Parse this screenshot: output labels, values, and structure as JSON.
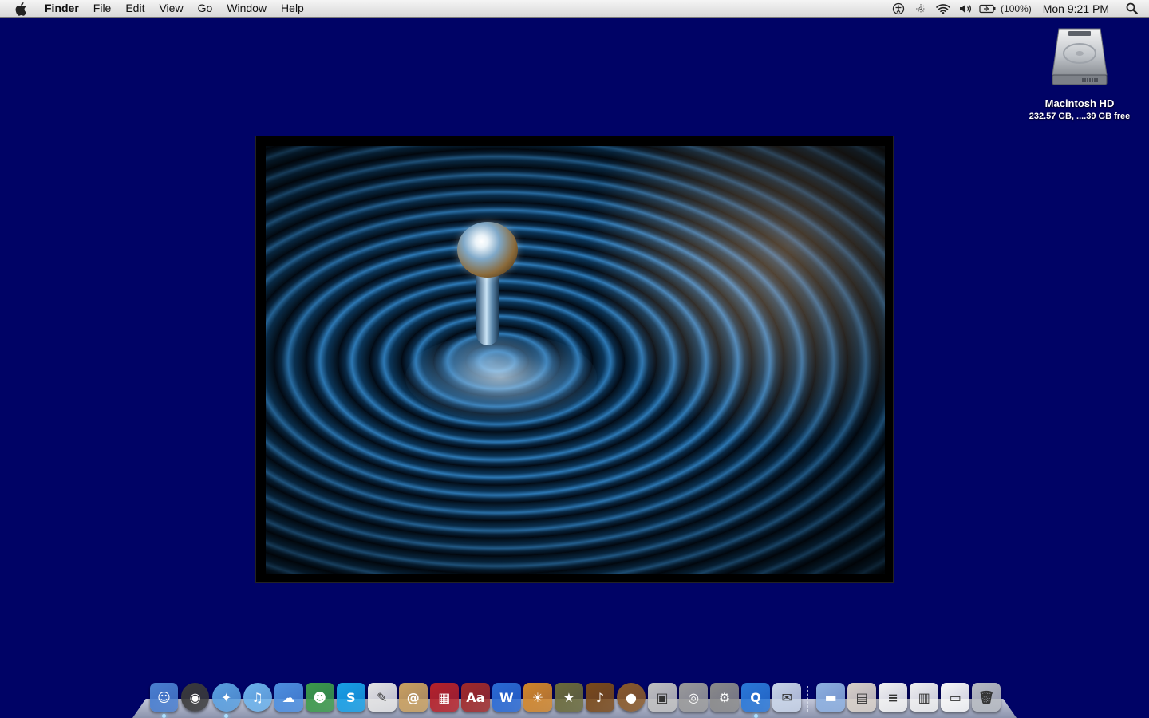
{
  "menubar": {
    "app_name": "Finder",
    "menus": [
      "File",
      "Edit",
      "View",
      "Go",
      "Window",
      "Help"
    ],
    "battery_percent": "(100%)",
    "clock": "Mon 9:21 PM"
  },
  "desktop": {
    "drive_name": "Macintosh HD",
    "drive_info": "232.57 GB, ....39 GB free",
    "background_color": "#000366"
  },
  "dock": {
    "apps": [
      {
        "name": "Finder",
        "icon": "finder-icon",
        "color": "#4a7fd0",
        "glyph": "☺",
        "running": true
      },
      {
        "name": "Dashboard",
        "icon": "dashboard-icon",
        "color": "#3a3a3a",
        "glyph": "◉",
        "running": false
      },
      {
        "name": "Safari",
        "icon": "safari-icon",
        "color": "#5aa0e0",
        "glyph": "✦",
        "running": true
      },
      {
        "name": "iTunes",
        "icon": "itunes-icon",
        "color": "#6db3ec",
        "glyph": "♫",
        "running": false
      },
      {
        "name": "iChat",
        "icon": "ichat-icon",
        "color": "#4d8fe0",
        "glyph": "☁",
        "running": false
      },
      {
        "name": "Messenger",
        "icon": "messenger-icon",
        "color": "#3c9a4a",
        "glyph": "☻",
        "running": false
      },
      {
        "name": "Skype",
        "icon": "skype-icon",
        "color": "#18a0e6",
        "glyph": "S",
        "running": false
      },
      {
        "name": "Preview",
        "icon": "preview-icon",
        "color": "#e4e4e4",
        "glyph": "✎",
        "running": false
      },
      {
        "name": "Address Book",
        "icon": "address-book-icon",
        "color": "#c9a060",
        "glyph": "@",
        "running": false
      },
      {
        "name": "Photo Booth",
        "icon": "photo-booth-icon",
        "color": "#b5222a",
        "glyph": "▦",
        "running": false
      },
      {
        "name": "Dictionary",
        "icon": "dictionary-icon",
        "color": "#a02a2a",
        "glyph": "Aa",
        "running": false
      },
      {
        "name": "iWeb",
        "icon": "iweb-icon",
        "color": "#2a6ad4",
        "glyph": "W",
        "running": false
      },
      {
        "name": "iPhoto",
        "icon": "iphoto-icon",
        "color": "#d0852a",
        "glyph": "☀",
        "running": false
      },
      {
        "name": "iMovie",
        "icon": "imovie-icon",
        "color": "#6a6a3a",
        "glyph": "★",
        "running": false
      },
      {
        "name": "GarageBand",
        "icon": "garageband-icon",
        "color": "#7a4a1a",
        "glyph": "♪",
        "running": false
      },
      {
        "name": "Coconut",
        "icon": "coconut-icon",
        "color": "#8a5a2a",
        "glyph": "●",
        "running": false
      },
      {
        "name": "Image Capture",
        "icon": "image-capture-icon",
        "color": "#c0c0c0",
        "glyph": "▣",
        "running": false
      },
      {
        "name": "DVD Player",
        "icon": "dvd-player-icon",
        "color": "#9a9a9a",
        "glyph": "◎",
        "running": false
      },
      {
        "name": "System Preferences",
        "icon": "system-preferences-icon",
        "color": "#8a8a8a",
        "glyph": "⚙",
        "running": false
      },
      {
        "name": "QuickTime",
        "icon": "quicktime-icon",
        "color": "#2a78d8",
        "glyph": "Q",
        "running": true
      },
      {
        "name": "Preview Viewer",
        "icon": "photo-viewer-icon",
        "color": "#c8d4e8",
        "glyph": "✉",
        "running": false
      }
    ],
    "stacks": [
      {
        "name": "Applications",
        "icon": "folder-icon",
        "color": "#8db0e0",
        "glyph": "▬"
      },
      {
        "name": "Document",
        "icon": "document-stack-icon",
        "color": "#d8d0c8",
        "glyph": "▤"
      },
      {
        "name": "RTF File",
        "icon": "rtf-file-icon",
        "color": "#f2f2f2",
        "glyph": "≡"
      },
      {
        "name": "Spreadsheet",
        "icon": "spreadsheet-icon",
        "color": "#f0f0f0",
        "glyph": "▥"
      },
      {
        "name": "Note",
        "icon": "note-icon",
        "color": "#f8f8f8",
        "glyph": "▭"
      },
      {
        "name": "Trash",
        "icon": "trash-icon",
        "color": "#b8bcc2",
        "glyph": "🗑"
      }
    ]
  }
}
